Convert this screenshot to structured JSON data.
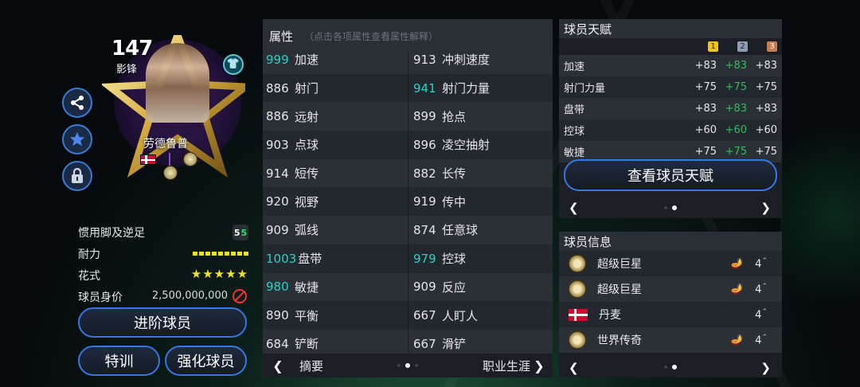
{
  "card": {
    "rating": "147",
    "position": "影锋",
    "name": "劳德鲁普",
    "jersey_icon": "shirt-icon"
  },
  "side_buttons": [
    "share-icon",
    "star-icon",
    "lock-icon"
  ],
  "info": {
    "foot_label": "惯用脚及逆足",
    "foot_main": "5",
    "foot_weak": "5",
    "stamina_label": "耐力",
    "skill_label": "花式",
    "skill_stars": "★★★★★",
    "value_label": "球员身价",
    "value": "2,500,000,000"
  },
  "buttons": {
    "upgrade": "进阶球员",
    "train": "特训",
    "enhance": "强化球员",
    "view_talent": "查看球员天赋"
  },
  "attributes": {
    "title": "属性",
    "hint": "（点击各项属性查看属性解释）",
    "rows": [
      {
        "lv": "999",
        "lhi": true,
        "ln": "加速",
        "rv": "913",
        "rhi": false,
        "rn": "冲刺速度"
      },
      {
        "lv": "886",
        "lhi": false,
        "ln": "射门",
        "rv": "941",
        "rhi": true,
        "rn": "射门力量"
      },
      {
        "lv": "886",
        "lhi": false,
        "ln": "远射",
        "rv": "899",
        "rhi": false,
        "rn": "抢点"
      },
      {
        "lv": "903",
        "lhi": false,
        "ln": "点球",
        "rv": "896",
        "rhi": false,
        "rn": "凌空抽射"
      },
      {
        "lv": "914",
        "lhi": false,
        "ln": "短传",
        "rv": "882",
        "rhi": false,
        "rn": "长传"
      },
      {
        "lv": "920",
        "lhi": false,
        "ln": "视野",
        "rv": "919",
        "rhi": false,
        "rn": "传中"
      },
      {
        "lv": "909",
        "lhi": false,
        "ln": "弧线",
        "rv": "874",
        "rhi": false,
        "rn": "任意球"
      },
      {
        "lv": "1003",
        "lhi": true,
        "ln": "盘带",
        "rv": "979",
        "rhi": true,
        "rn": "控球"
      },
      {
        "lv": "980",
        "lhi": true,
        "ln": "敏捷",
        "rv": "909",
        "rhi": false,
        "rn": "反应"
      },
      {
        "lv": "890",
        "lhi": false,
        "ln": "平衡",
        "rv": "667",
        "rhi": false,
        "rn": "人盯人"
      },
      {
        "lv": "684",
        "lhi": false,
        "ln": "铲断",
        "rv": "667",
        "rhi": false,
        "rn": "滑铲"
      }
    ],
    "footer_left": "摘要",
    "footer_right": "职业生涯"
  },
  "talent": {
    "title": "球员天赋",
    "tiers": [
      "1",
      "2",
      "3"
    ],
    "rows": [
      {
        "name": "加速",
        "t1": "+83",
        "t2": "+83",
        "t3": "+83"
      },
      {
        "name": "射门力量",
        "t1": "+75",
        "t2": "+75",
        "t3": "+75"
      },
      {
        "name": "盘带",
        "t1": "+83",
        "t2": "+83",
        "t3": "+83"
      },
      {
        "name": "控球",
        "t1": "+60",
        "t2": "+60",
        "t3": "+60"
      },
      {
        "name": "敏捷",
        "t1": "+75",
        "t2": "+75",
        "t3": "+75"
      }
    ]
  },
  "player_info": {
    "title": "球员信息",
    "rows": [
      {
        "icon": "superstar-badge-icon",
        "label": "超级巨星",
        "count": "4",
        "lamp": true
      },
      {
        "icon": "superstar-badge-icon",
        "label": "超级巨星",
        "count": "4",
        "lamp": true
      },
      {
        "icon": "denmark-flag-icon",
        "label": "丹麦",
        "count": "4",
        "lamp": false
      },
      {
        "icon": "legend-badge-icon",
        "label": "世界传奇",
        "count": "4",
        "lamp": true
      }
    ]
  },
  "colors": {
    "accent_blue": "#3578e5",
    "highlight_teal": "#27d3c6",
    "talent_green": "#2fbf5a",
    "star_yellow": "#f2e41a"
  }
}
